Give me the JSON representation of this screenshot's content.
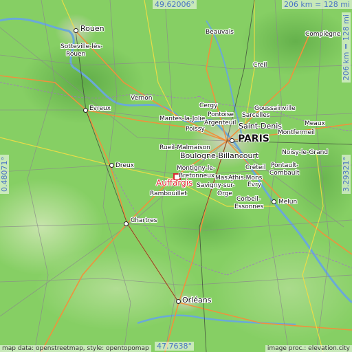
{
  "map": {
    "highlight_label": "Auffargis",
    "accent_color": "#e0262c",
    "coord_color": "#4a74c4",
    "places": {
      "rouen": "Rouen",
      "sotteville": "Sotteville-lès-",
      "sotteville2": "Rouen",
      "beauvais": "Beauvais",
      "compiegne": "Compiègne",
      "creil": "Creil",
      "vernon": "Vernon",
      "evreux": "Evreux",
      "cergy": "Cergy",
      "pontoise": "Pontoise",
      "sarcelles": "Sarcelles",
      "goussainville": "Goussainville",
      "mantes": "Mantes-la-Jolie",
      "argenteuil": "Argenteuil",
      "poissy": "Poissy",
      "saint_denis": "Saint-Denis",
      "meaux": "Meaux",
      "paris": "PARIS",
      "montfermeil": "Montfermeil",
      "rueil": "Rueil-Malmaison",
      "noisy": "Noisy-le-Grand",
      "boulogne": "Boulogne-Billancourt",
      "dreux": "Dreux",
      "montigny": "Montigny-le-",
      "bretonneux": "Bretonneux",
      "creteil": "Créteil",
      "pontault": "Pontault-",
      "combault": "Combault",
      "massy": "Massy",
      "athis": "Athis-Mons",
      "savigny": "Savigny-sur-",
      "orge": "Orge",
      "evry": "Évry",
      "rambouillet": "Rambouillet",
      "corbeil": "Corbeil-",
      "essonnes": "Essonnes",
      "melun": "Melun",
      "chartres": "Chartres",
      "orleans": "Orléans"
    },
    "coords": {
      "top": "49.62006°",
      "bottom": "47.7638°",
      "left": "0.48071°",
      "right": "3.29321°"
    },
    "scale": {
      "horizontal": "206 km = 128 mi",
      "vertical": "206 km = 128 mi"
    },
    "attribution": {
      "left": "map data: openstreetmap, style: opentopomap",
      "right": "image proc.: elevation.city"
    }
  }
}
